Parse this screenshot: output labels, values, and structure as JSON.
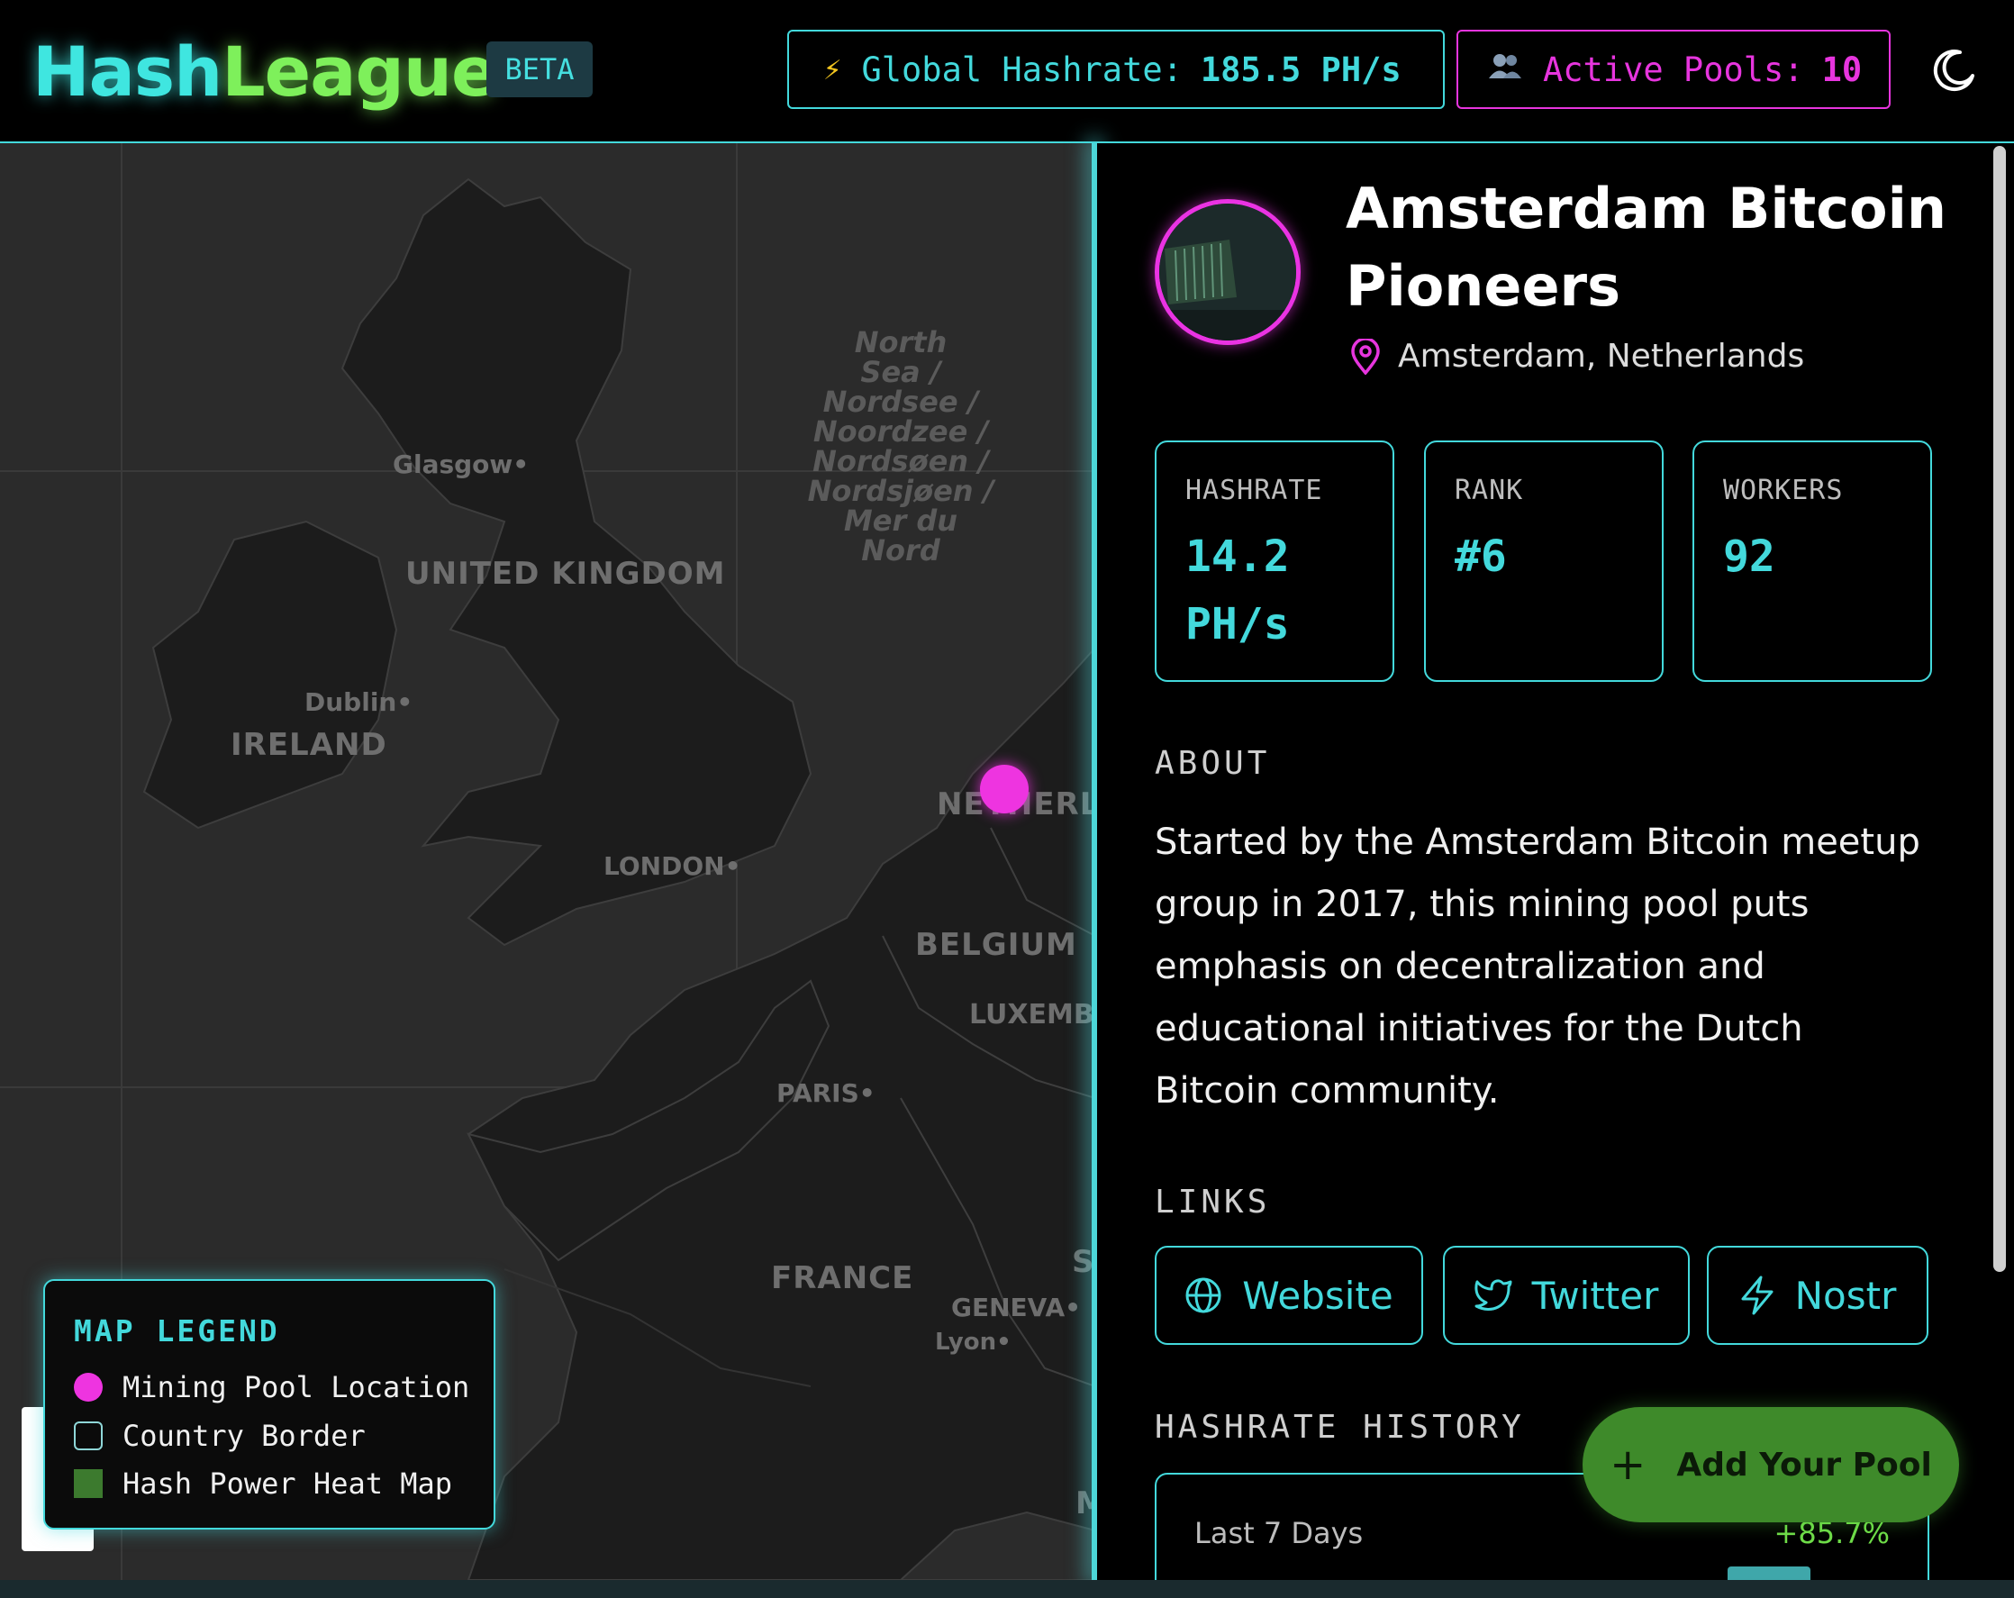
{
  "header": {
    "logo_part1": "Hash",
    "logo_part2": "League",
    "badge": "BETA",
    "global_hashrate_label": "Global Hashrate:",
    "global_hashrate_value": "185.5 PH/s",
    "active_pools_label": "Active Pools:",
    "active_pools_value": "10",
    "theme_icon": "moon-icon"
  },
  "map": {
    "sea_label": [
      "North",
      "Sea /",
      "Nordsee /",
      "Noordzee /",
      "Nordsøen /",
      "Nordsjøen /",
      "Mer du",
      "Nord"
    ],
    "countries": {
      "uk": "UNITED KINGDOM",
      "ireland": "IRELAND",
      "netherlands": "NETHERLANDS",
      "belgium": "BELGIUM",
      "luxembourg": "LUXEMB",
      "france": "FRANCE",
      "switzerland": "S",
      "monaco": "M"
    },
    "cities": {
      "glasgow": "Glasgow",
      "dublin": "Dublin",
      "london": "LONDON",
      "paris": "PARIS",
      "geneva": "GENEVA",
      "lyon": "Lyon"
    },
    "legend": {
      "title": "MAP LEGEND",
      "items": [
        "Mining Pool Location",
        "Country Border",
        "Hash Power Heat Map"
      ]
    }
  },
  "pool": {
    "name": "Amsterdam Bitcoin Pioneers",
    "location": "Amsterdam, Netherlands",
    "stats": {
      "hashrate_label": "HASHRATE",
      "hashrate_value": "14.2 PH/s",
      "rank_label": "RANK",
      "rank_value": "#6",
      "workers_label": "WORKERS",
      "workers_value": "92"
    },
    "about_title": "ABOUT",
    "about_text": "Started by the Amsterdam Bitcoin meetup group in 2017, this mining pool puts emphasis on decentralization and educational initiatives for the Dutch Bitcoin community.",
    "links_title": "LINKS",
    "links": {
      "website": "Website",
      "twitter": "Twitter",
      "nostr": "Nostr"
    },
    "history_title": "HASHRATE HISTORY",
    "history_range": "Last 7 Days",
    "history_change": "+85.7%"
  },
  "actions": {
    "add_pool": "Add Your Pool"
  },
  "colors": {
    "accent_cyan": "#43d9dc",
    "accent_magenta": "#e735de",
    "accent_green": "#7ef05b"
  }
}
